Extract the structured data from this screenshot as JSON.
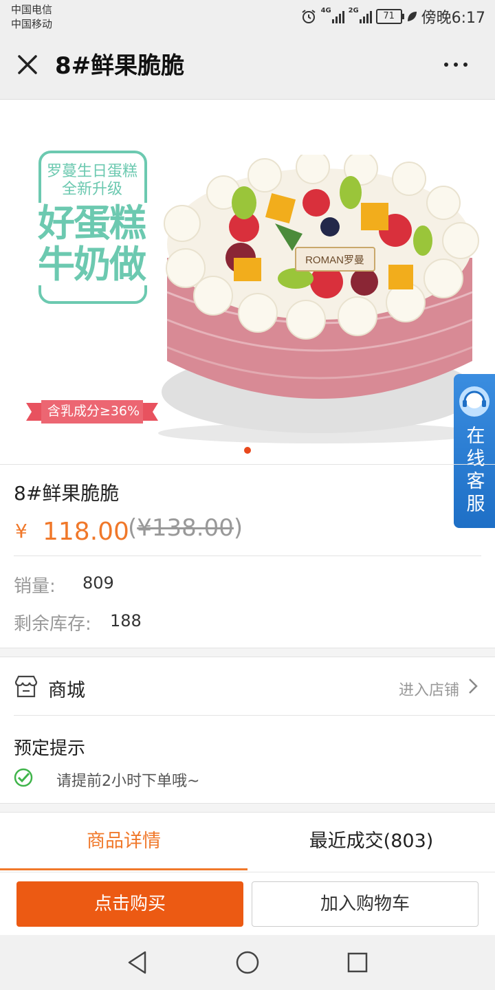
{
  "status_bar": {
    "carrier1": "中国电信",
    "carrier2": "中国移动",
    "net1": "4G",
    "net2": "2G",
    "battery": "71",
    "time": "傍晚6:17"
  },
  "nav": {
    "title": "8#鲜果脆脆",
    "close_icon": "close-icon",
    "more_icon": "more-icon"
  },
  "hero": {
    "promo_subtitle_1": "罗蔓生日蛋糕",
    "promo_subtitle_2": "全新升级",
    "promo_line_1": "好蛋糕",
    "promo_line_2": "牛奶做",
    "plaque_text": "ROMAN罗曼",
    "ribbon_text": "含乳成分≥36%",
    "slide_count": 1
  },
  "service": {
    "label": "在线客服"
  },
  "product": {
    "name": "8#鲜果脆脆",
    "currency": "¥",
    "price": "118.00",
    "original_price_open": "(",
    "original_price": "¥138.00",
    "original_price_close": ")",
    "sales_label": "销量:",
    "sales_value": "809",
    "stock_label": "剩余库存:",
    "stock_value": "188"
  },
  "store": {
    "label": "商城",
    "link": "进入店铺"
  },
  "notice": {
    "title": "预定提示",
    "text": "请提前2小时下单哦~"
  },
  "tabs": [
    {
      "label": "商品详情",
      "active": true
    },
    {
      "label": "最近成交(803)",
      "active": false
    }
  ],
  "actions": {
    "buy": "点击购买",
    "cart": "加入购物车"
  },
  "colors": {
    "accent": "#f0782a",
    "buy_button": "#ec5a13",
    "promo_teal": "#6cc9b0",
    "service_blue": "#2a7fd6"
  }
}
